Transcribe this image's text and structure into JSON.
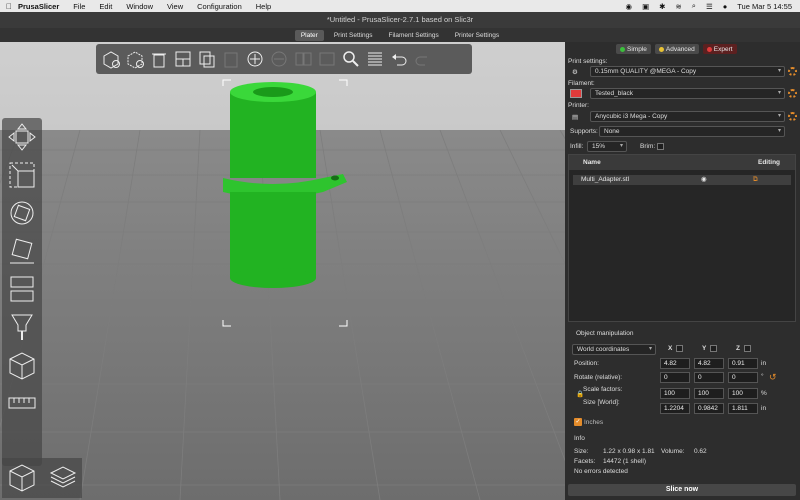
{
  "menubar": {
    "app": "PrusaSlicer",
    "items": [
      "File",
      "Edit",
      "Window",
      "View",
      "Configuration",
      "Help"
    ],
    "clock": "Tue Mar 5  14:55"
  },
  "window": {
    "title": "*Untitled - PrusaSlicer-2.7.1 based on Slic3r"
  },
  "tabs": [
    "Plater",
    "Print Settings",
    "Filament Settings",
    "Printer Settings"
  ],
  "modes": [
    {
      "label": "Simple",
      "color": "#3cbf3c"
    },
    {
      "label": "Advanced",
      "color": "#e8c234"
    },
    {
      "label": "Expert",
      "color": "#e03b3b"
    }
  ],
  "settings": {
    "print_label": "Print settings:",
    "print_value": "0.15mm QUALITY @MEGA - Copy",
    "filament_label": "Filament:",
    "filament_value": "Tested_black",
    "filament_color": "#e03b3b",
    "printer_label": "Printer:",
    "printer_value": "Anycubic i3 Mega - Copy",
    "supports_label": "Supports:",
    "supports_value": "None",
    "infill_label": "Infill:",
    "infill_value": "15%",
    "brim_label": "Brim:"
  },
  "object_list": {
    "col_name": "Name",
    "col_editing": "Editing",
    "rows": [
      "Multi_Adapter.stl"
    ]
  },
  "object_manipulation": {
    "title": "Object manipulation",
    "coords": "World coordinates",
    "x": "X",
    "y": "Y",
    "z": "Z",
    "position_label": "Position:",
    "position": [
      "4.82",
      "4.82",
      "0.91"
    ],
    "position_unit": "in",
    "rotate_label": "Rotate (relative):",
    "rotate": [
      "0",
      "0",
      "0"
    ],
    "rotate_unit": "°",
    "scale_label": "Scale factors:",
    "scale": [
      "100",
      "100",
      "100"
    ],
    "scale_unit": "%",
    "size_label": "Size [World]:",
    "size": [
      "1.2204",
      "0.9842",
      "1.811"
    ],
    "size_unit": "in",
    "inches_label": "Inches"
  },
  "info": {
    "title": "Info",
    "size_label": "Size:",
    "size_value": "1.22 x 0.98 x 1.81",
    "volume_label": "Volume:",
    "volume_value": "0.62",
    "facets_label": "Facets:",
    "facets_value": "14472 (1 shell)",
    "errors": "No errors detected"
  },
  "slice_button": "Slice now"
}
